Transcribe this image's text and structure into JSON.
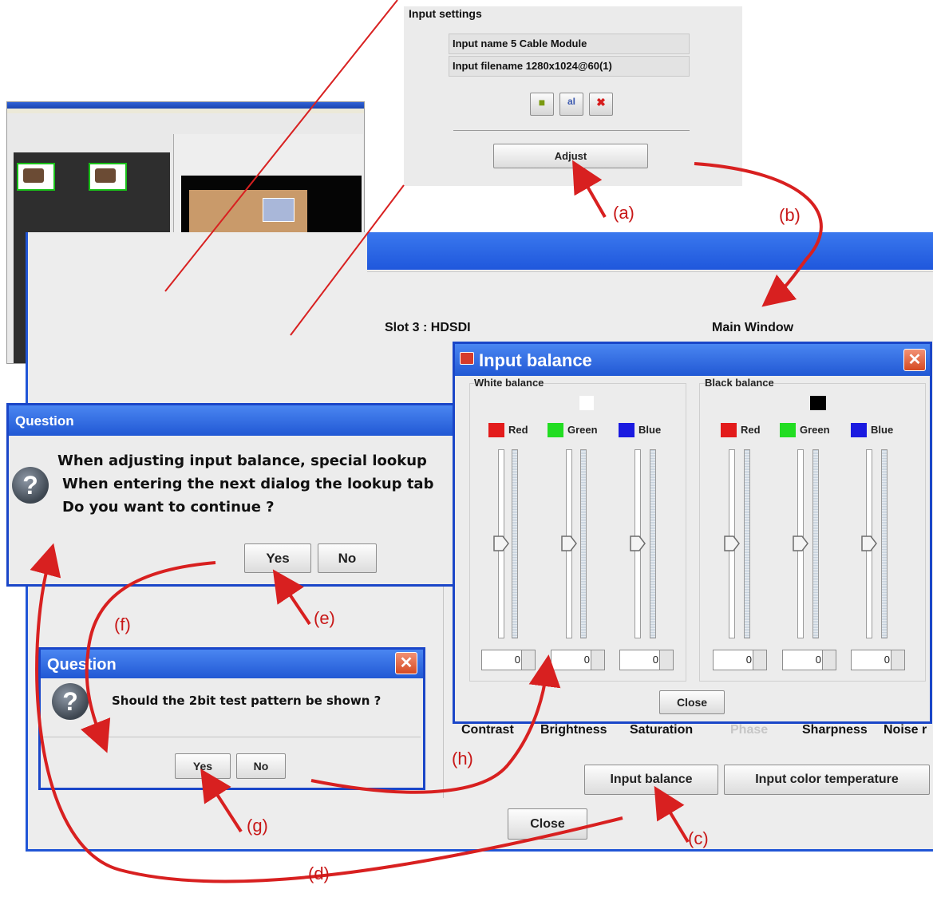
{
  "input_settings": {
    "title": "Input settings",
    "input_name_label": "Input name",
    "input_name_value": "5 Cable Module",
    "input_filename_label": "Input filename",
    "input_filename_value": "1280x1024@60(1)",
    "adjust_button": "Adjust"
  },
  "main_window": {
    "slot_label": "Slot  3 : HDSDI",
    "main_window_label": "Main Window",
    "tabs": [
      "Contrast",
      "Brightness",
      "Saturation",
      "Phase",
      "Sharpness",
      "Noise r"
    ],
    "input_balance_button": "Input balance",
    "input_color_temperature_button": "Input color temperature",
    "close_button": "Close"
  },
  "question_dialog": {
    "title": "Question",
    "line1": "When adjusting input balance, special lookup",
    "line2": "When entering the next dialog the lookup tab",
    "line3": "Do you want to continue ?",
    "yes_button": "Yes",
    "no_button": "No"
  },
  "question_dialog_2": {
    "title": "Question",
    "message": "Should the 2bit test pattern be shown ?",
    "yes_button": "Yes",
    "no_button": "No"
  },
  "input_balance_dialog": {
    "title": "Input balance",
    "white_balance": {
      "title": "White balance",
      "channels": [
        {
          "label": "Red",
          "value": "0",
          "color": "#e31b1b"
        },
        {
          "label": "Green",
          "value": "0",
          "color": "#22dd22"
        },
        {
          "label": "Blue",
          "value": "0",
          "color": "#1a1ae0"
        }
      ]
    },
    "black_balance": {
      "title": "Black balance",
      "channels": [
        {
          "label": "Red",
          "value": "0",
          "color": "#e31b1b"
        },
        {
          "label": "Green",
          "value": "0",
          "color": "#22dd22"
        },
        {
          "label": "Blue",
          "value": "0",
          "color": "#1a1ae0"
        }
      ]
    },
    "close_button": "Close"
  },
  "annotations": {
    "a": "(a)",
    "b": "(b)",
    "c": "(c)",
    "d": "(d)",
    "e": "(e)",
    "f": "(f)",
    "g": "(g)",
    "h": "(h)"
  },
  "colors": {
    "titlebar_blue": "#2158d4",
    "annotation_red": "#d82020",
    "close_x": "#d54a23"
  }
}
